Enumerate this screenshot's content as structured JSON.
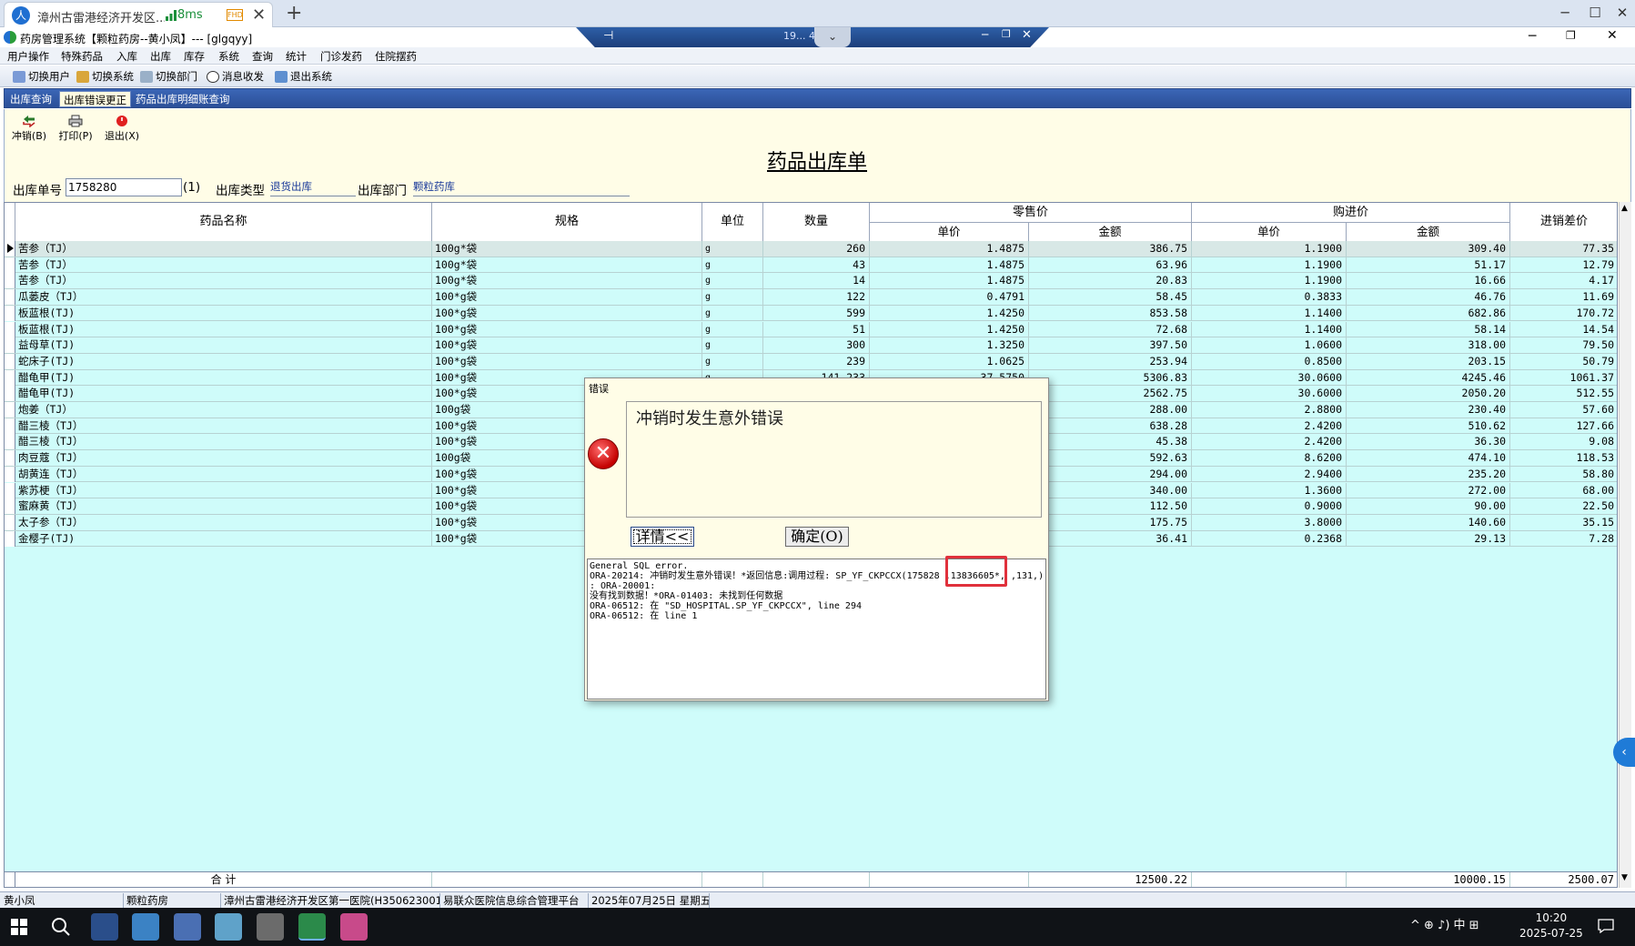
{
  "browser": {
    "tab_title": "漳州古雷港经济开发区...",
    "latency": "8ms",
    "quality_badge": "FHD",
    "avatar_glyph": "人",
    "new_tab": "+",
    "close_tab": "✕"
  },
  "remote_bar": {
    "ip": "19... 42"
  },
  "app": {
    "title": "药房管理系统【颗粒药房--黄小凤】--- [glgqyy]",
    "menu": [
      "用户操作",
      "特殊药品",
      "入库",
      "出库",
      "库存",
      "系统",
      "查询",
      "统计",
      "门诊发药",
      "住院摆药"
    ],
    "toolbar": [
      "切换用户",
      "切换系统",
      "切换部门",
      "消息收发",
      "退出系统"
    ],
    "tabs": [
      "出库查询",
      "出库错误更正",
      "药品出库明细账查询"
    ],
    "active_tab": 1
  },
  "form": {
    "buttons": [
      "冲销(B)",
      "打印(P)",
      "退出(X)"
    ],
    "doc_title": "药品出库单",
    "out_no_label": "出库单号",
    "out_no_value": "1758280",
    "out_no_suffix": "(1)",
    "out_type_label": "出库类型",
    "out_type_value": "退货出库",
    "dept_label": "出库部门",
    "dept_value": "颗粒药库"
  },
  "grid": {
    "headers": {
      "name": "药品名称",
      "spec": "规格",
      "unit": "单位",
      "qty": "数量",
      "retail": "零售价",
      "purchase": "购进价",
      "diff": "进销差价",
      "unit_price": "单价",
      "amount": "金额"
    },
    "rows": [
      [
        "苦参（TJ）",
        "100g*袋",
        "g",
        "260",
        "1.4875",
        "386.75",
        "1.1900",
        "309.40",
        "77.35"
      ],
      [
        "苦参（TJ）",
        "100g*袋",
        "g",
        "43",
        "1.4875",
        "63.96",
        "1.1900",
        "51.17",
        "12.79"
      ],
      [
        "苦参（TJ）",
        "100g*袋",
        "g",
        "14",
        "1.4875",
        "20.83",
        "1.1900",
        "16.66",
        "4.17"
      ],
      [
        "瓜蒌皮（TJ）",
        "100*g袋",
        "g",
        "122",
        "0.4791",
        "58.45",
        "0.3833",
        "46.76",
        "11.69"
      ],
      [
        "板蓝根(TJ)",
        "100*g袋",
        "g",
        "599",
        "1.4250",
        "853.58",
        "1.1400",
        "682.86",
        "170.72"
      ],
      [
        "板蓝根(TJ)",
        "100*g袋",
        "g",
        "51",
        "1.4250",
        "72.68",
        "1.1400",
        "58.14",
        "14.54"
      ],
      [
        "益母草(TJ)",
        "100*g袋",
        "g",
        "300",
        "1.3250",
        "397.50",
        "1.0600",
        "318.00",
        "79.50"
      ],
      [
        "蛇床子(TJ)",
        "100*g袋",
        "g",
        "239",
        "1.0625",
        "253.94",
        "0.8500",
        "203.15",
        "50.79"
      ],
      [
        "醋龟甲(TJ)",
        "100*g袋",
        "g",
        "141.233",
        "37.5750",
        "5306.83",
        "30.0600",
        "4245.46",
        "1061.37"
      ],
      [
        "醋龟甲(TJ)",
        "100*g袋",
        "",
        "",
        "",
        "2562.75",
        "30.6000",
        "2050.20",
        "512.55"
      ],
      [
        "炮姜（TJ）",
        "100g袋",
        "",
        "",
        "",
        "288.00",
        "2.8800",
        "230.40",
        "57.60"
      ],
      [
        "醋三棱（TJ）",
        "100*g袋",
        "",
        "",
        "",
        "638.28",
        "2.4200",
        "510.62",
        "127.66"
      ],
      [
        "醋三棱（TJ）",
        "100*g袋",
        "",
        "",
        "",
        "45.38",
        "2.4200",
        "36.30",
        "9.08"
      ],
      [
        "肉豆蔻（TJ）",
        "100g袋",
        "",
        "",
        "",
        "592.63",
        "8.6200",
        "474.10",
        "118.53"
      ],
      [
        "胡黄连（TJ）",
        "100*g袋",
        "",
        "",
        "",
        "294.00",
        "2.9400",
        "235.20",
        "58.80"
      ],
      [
        "紫苏梗（TJ）",
        "100*g袋",
        "",
        "",
        "",
        "340.00",
        "1.3600",
        "272.00",
        "68.00"
      ],
      [
        "蜜麻黄（TJ）",
        "100*g袋",
        "",
        "",
        "",
        "112.50",
        "0.9000",
        "90.00",
        "22.50"
      ],
      [
        "太子参（TJ）",
        "100*g袋",
        "",
        "",
        "",
        "175.75",
        "3.8000",
        "140.60",
        "35.15"
      ],
      [
        "金樱子(TJ)",
        "100*g袋",
        "",
        "",
        "",
        "36.41",
        "0.2368",
        "29.13",
        "7.28"
      ]
    ],
    "footer": {
      "label": "合 计",
      "retail_total": "12500.22",
      "purchase_total": "10000.15",
      "diff_total": "2500.07"
    }
  },
  "dialog": {
    "title": "错误",
    "message": "冲销时发生意外错误",
    "detail_button": "详情<<",
    "ok_button": "确定(O)",
    "detail_text": "General SQL error.\nORA-20214: 冲销时发生意外错误！*返回信息:调用过程: SP_YF_CKPCCX(175828 ,13836605*, ,131,)\n: ORA-20001:\n没有找到数据！*ORA-01403: 未找到任何数据\nORA-06512: 在 \"SD_HOSPITAL.SP_YF_CKPCCX\", line 294\nORA-06512: 在 line 1"
  },
  "status": {
    "cells": [
      "黄小凤",
      "颗粒药房",
      "漳州古雷港经济开发区第一医院(H35062300184)",
      "易联众医院信息综合管理平台",
      "2025年07月25日 星期五"
    ]
  },
  "taskbar": {
    "tray": "^  ⊕  ♪)  中  ⊞",
    "time": "10:20",
    "date": "2025-07-25"
  },
  "colors": {
    "grid_bg": "#cffcfa",
    "form_bg": "#fffde7",
    "tabstrip": "#2b4f98",
    "error_red": "#c40000",
    "highlight": "#e0303b"
  }
}
